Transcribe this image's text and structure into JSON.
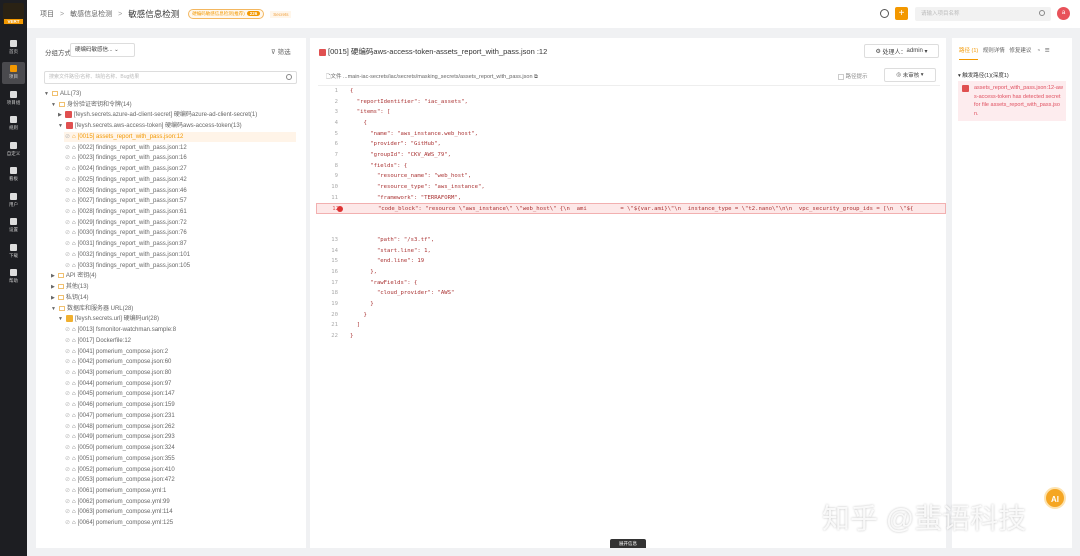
{
  "sidebar": {
    "logo_text": "VERT",
    "items": [
      {
        "label": "首页",
        "icon": "home-icon"
      },
      {
        "label": "项目",
        "icon": "project-icon",
        "active": true
      },
      {
        "label": "项目组",
        "icon": "project-group-icon"
      },
      {
        "label": "规则",
        "icon": "rules-icon"
      },
      {
        "label": "自定义",
        "icon": "custom-icon"
      },
      {
        "label": "看板",
        "icon": "dashboard-icon"
      },
      {
        "label": "用户",
        "icon": "user-icon"
      },
      {
        "label": "设置",
        "icon": "settings-icon"
      },
      {
        "label": "下载",
        "icon": "download-icon"
      },
      {
        "label": "帮助",
        "icon": "help-icon"
      }
    ]
  },
  "header": {
    "breadcrumb": [
      "项目",
      "敏感信息检测",
      "敏感信息检测"
    ],
    "tag_label": "硬编码敏感信息检测(推荐)",
    "tag_count": "226",
    "secrets_tag": "Secrets",
    "search_placeholder": "请输入项目名称",
    "avatar": "a"
  },
  "left": {
    "group_label": "分组方式",
    "group_value": "硬编码敏感信...",
    "filter_label": "筛选",
    "search_placeholder": "搜索文件路径/名称、缺陷名称、Bug结果",
    "tree": [
      {
        "level": 0,
        "text": "ALL(73)",
        "type": "folder",
        "open": true
      },
      {
        "level": 1,
        "text": "身份验证密钥和令牌(14)",
        "type": "folder",
        "open": true
      },
      {
        "level": 2,
        "text": "[feysh.secrets.azure-ad-client-secret] 硬编码azure-ad-client-secret(1)",
        "type": "red",
        "open": false
      },
      {
        "level": 2,
        "text": "[feysh.secrets.aws-access-token] 硬编码aws-access-token(13)",
        "type": "red",
        "open": true
      },
      {
        "level": 3,
        "text": "[0015] assets_report_with_pass.json:12",
        "selected": true
      },
      {
        "level": 3,
        "text": "[0022] findings_report_with_pass.json:12"
      },
      {
        "level": 3,
        "text": "[0023] findings_report_with_pass.json:16"
      },
      {
        "level": 3,
        "text": "[0024] findings_report_with_pass.json:27"
      },
      {
        "level": 3,
        "text": "[0025] findings_report_with_pass.json:42"
      },
      {
        "level": 3,
        "text": "[0026] findings_report_with_pass.json:46"
      },
      {
        "level": 3,
        "text": "[0027] findings_report_with_pass.json:57"
      },
      {
        "level": 3,
        "text": "[0028] findings_report_with_pass.json:61"
      },
      {
        "level": 3,
        "text": "[0029] findings_report_with_pass.json:72"
      },
      {
        "level": 3,
        "text": "[0030] findings_report_with_pass.json:76"
      },
      {
        "level": 3,
        "text": "[0031] findings_report_with_pass.json:87"
      },
      {
        "level": 3,
        "text": "[0032] findings_report_with_pass.json:101"
      },
      {
        "level": 3,
        "text": "[0033] findings_report_with_pass.json:105"
      },
      {
        "level": 1,
        "text": "API 密钥(4)",
        "type": "folder",
        "open": false
      },
      {
        "level": 1,
        "text": "其他(13)",
        "type": "folder",
        "open": false
      },
      {
        "level": 1,
        "text": "私钥(14)",
        "type": "folder",
        "open": false
      },
      {
        "level": 1,
        "text": "数据库和服务器 URL(28)",
        "type": "folder",
        "open": true
      },
      {
        "level": 2,
        "text": "[feysh.secrets.url] 硬编码url(28)",
        "type": "yellow",
        "open": true
      },
      {
        "level": 3,
        "text": "[0013] fsmonitor-watchman.sample:8"
      },
      {
        "level": 3,
        "text": "[0017] Dockerfile:12"
      },
      {
        "level": 3,
        "text": "[0041] pomerium_compose.json:2"
      },
      {
        "level": 3,
        "text": "[0042] pomerium_compose.json:60"
      },
      {
        "level": 3,
        "text": "[0043] pomerium_compose.json:80"
      },
      {
        "level": 3,
        "text": "[0044] pomerium_compose.json:97"
      },
      {
        "level": 3,
        "text": "[0045] pomerium_compose.json:147"
      },
      {
        "level": 3,
        "text": "[0046] pomerium_compose.json:159"
      },
      {
        "level": 3,
        "text": "[0047] pomerium_compose.json:231"
      },
      {
        "level": 3,
        "text": "[0048] pomerium_compose.json:262"
      },
      {
        "level": 3,
        "text": "[0049] pomerium_compose.json:293"
      },
      {
        "level": 3,
        "text": "[0050] pomerium_compose.json:324"
      },
      {
        "level": 3,
        "text": "[0051] pomerium_compose.json:355"
      },
      {
        "level": 3,
        "text": "[0052] pomerium_compose.json:410"
      },
      {
        "level": 3,
        "text": "[0053] pomerium_compose.json:472"
      },
      {
        "level": 3,
        "text": "[0061] pomerium_compose.yml:1"
      },
      {
        "level": 3,
        "text": "[0062] pomerium_compose.yml:99"
      },
      {
        "level": 3,
        "text": "[0063] pomerium_compose.yml:114"
      },
      {
        "level": 3,
        "text": "[0064] pomerium_compose.yml:125"
      }
    ]
  },
  "main": {
    "title": "[0015] 硬编码aws-access-token-assets_report_with_pass.json :12",
    "assignee_label": "处理人：",
    "assignee": "admin",
    "file_label": "文件",
    "file_path": "...main-iac-secrets/iac/secrets/masking_secrets/assets_report_with_pass.json",
    "path_hint_label": "路径提示",
    "status": "未审核",
    "expand_label": "展开信息",
    "code": [
      {
        "n": "1",
        "t": "{"
      },
      {
        "n": "2",
        "t": "  \"reportIdentifier\": \"iac_assets\","
      },
      {
        "n": "3",
        "t": "  \"items\": ["
      },
      {
        "n": "4",
        "t": "    {"
      },
      {
        "n": "5",
        "t": "      \"name\": \"aws_instance.web_host\","
      },
      {
        "n": "6",
        "t": "      \"provider\": \"GitHub\","
      },
      {
        "n": "7",
        "t": "      \"groupId\": \"CKV_AWS_79\","
      },
      {
        "n": "8",
        "t": "      \"fields\": {"
      },
      {
        "n": "9",
        "t": "        \"resource_name\": \"web_host\","
      },
      {
        "n": "10",
        "t": "        \"resource_type\": \"aws_instance\","
      },
      {
        "n": "11",
        "t": "        \"framework\": \"TERRAFORM\","
      },
      {
        "n": "12",
        "t": "        \"code_block\": \"resource \\\"aws_instance\\\" \\\"web_host\\\" {\\n  ami          = \\\"${var.ami}\\\"\\n  instance_type = \\\"t2.nano\\\"\\n\\n  vpc_security_group_ids = [\\n  \\\"${",
        "err": true
      },
      {
        "n": "",
        "t": ""
      },
      {
        "n": "",
        "t": ""
      },
      {
        "n": "13",
        "t": "        \"path\": \"/s3.tf\","
      },
      {
        "n": "14",
        "t": "        \"start.line\": 1,"
      },
      {
        "n": "15",
        "t": "        \"end.line\": 19"
      },
      {
        "n": "16",
        "t": "      },"
      },
      {
        "n": "17",
        "t": "      \"rawFields\": {"
      },
      {
        "n": "18",
        "t": "        \"cloud_provider\": \"AWS\""
      },
      {
        "n": "19",
        "t": "      }"
      },
      {
        "n": "20",
        "t": "    }"
      },
      {
        "n": "21",
        "t": "  ]"
      },
      {
        "n": "22",
        "t": "}"
      }
    ]
  },
  "right": {
    "tabs": [
      "路径 (1)",
      "规则详情",
      "修复建议"
    ],
    "trigger_label": "触发路径(1)(深度1)",
    "trigger_text": "assets_report_with_pass.json:12-aws-access-token has detected secret for file assets_report_with_pass.json."
  },
  "watermark": "知乎 @蜚语科技",
  "ai_button": "AI",
  "colors": {
    "accent": "#f39800",
    "error": "#e05050",
    "sidebar": "#1d1e22"
  }
}
